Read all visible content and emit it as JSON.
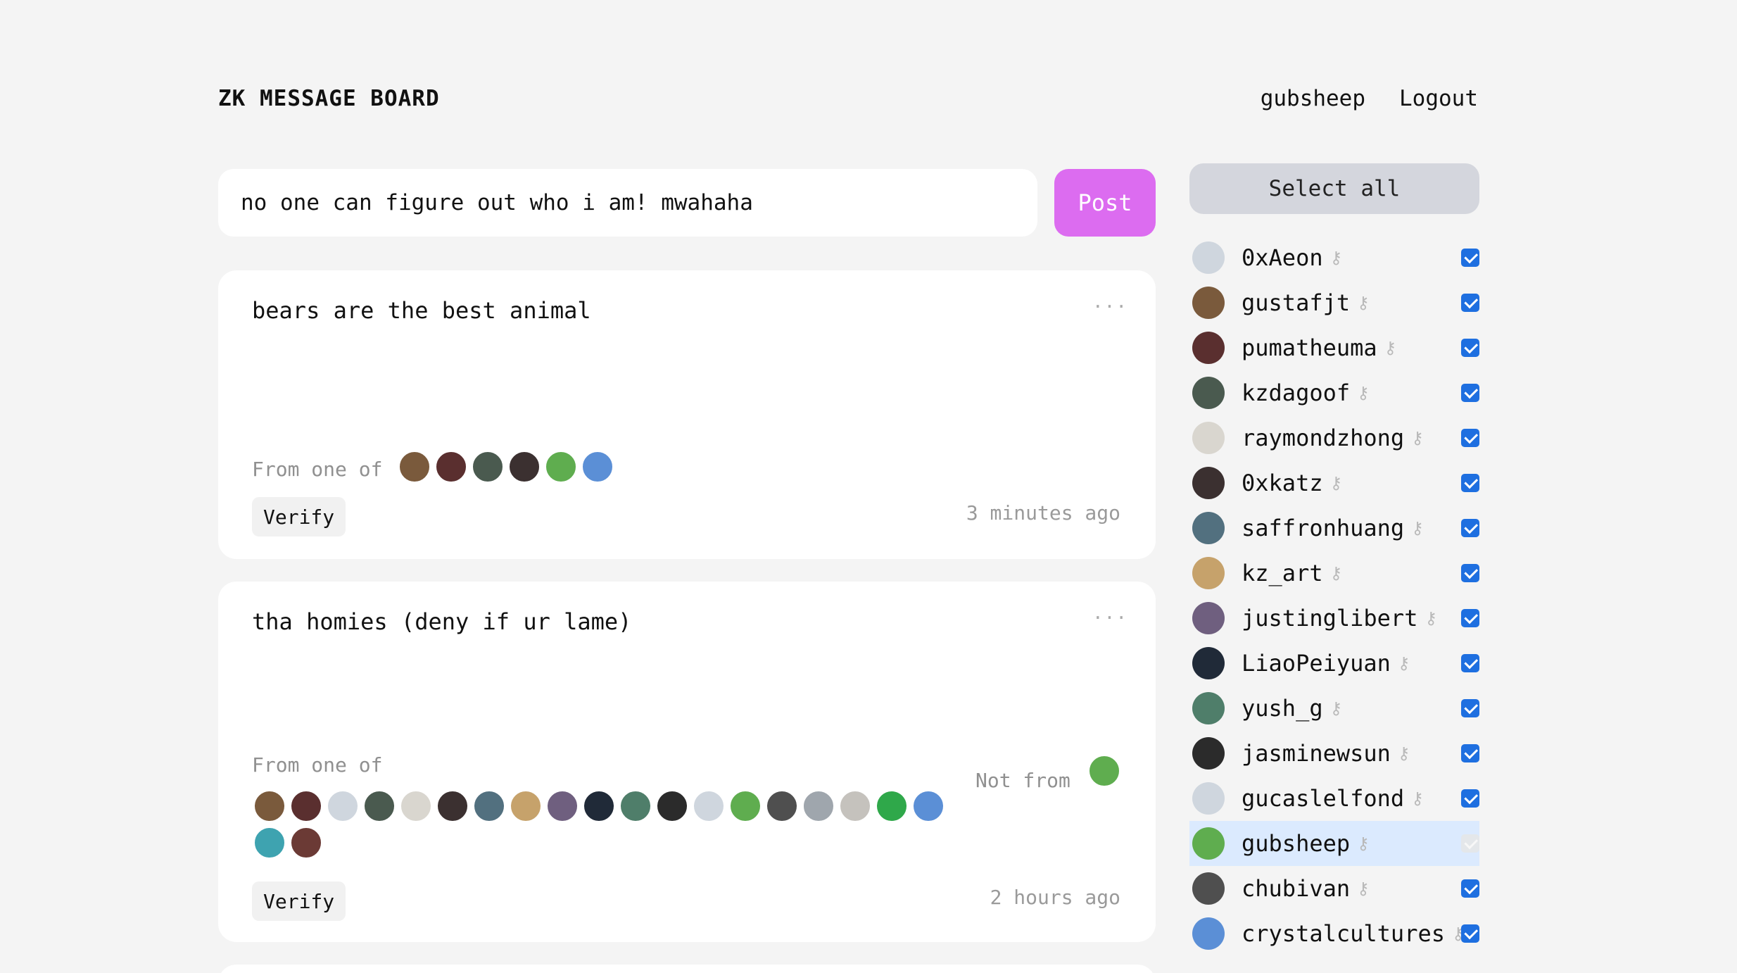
{
  "header": {
    "brand": "ZK MESSAGE BOARD",
    "username": "gubsheep",
    "logout_label": "Logout"
  },
  "composer": {
    "value": "no one can figure out who i am! mwahaha",
    "post_label": "Post"
  },
  "posts": [
    {
      "text": "bears are the best animal",
      "more": "...",
      "from_label": "From one of",
      "verify_label": "Verify",
      "timestamp": "3 minutes ago",
      "from_avatars": [
        "#7a5a3c",
        "#5a2f2f",
        "#4a5a4f",
        "#3b3030",
        "#5fad4f",
        "#5b8fd6"
      ]
    },
    {
      "text": "tha homies (deny if ur lame)",
      "more": "...",
      "from_label": "From one of",
      "not_from_label": "Not from",
      "verify_label": "Verify",
      "timestamp": "2 hours ago",
      "from_avatars": [
        "#7a5a3c",
        "#5a2f2f",
        "#cfd6de",
        "#4a5a4f",
        "#d9d6cf",
        "#3b3030",
        "#52707f",
        "#c6a26b",
        "#6f5f7f",
        "#202a38",
        "#4f7e6a",
        "#2b2b2b",
        "#cfd6de",
        "#5fad4f",
        "#4f4f4f",
        "#9fa6ad",
        "#c5c2bd",
        "#2fa84a",
        "#5b8fd6",
        "#3ea3b0",
        "#6b3a35"
      ],
      "not_from_avatars": [
        "#5fad4f"
      ]
    }
  ],
  "sidebar": {
    "select_all_label": "Select all",
    "users": [
      {
        "name": "0xAeon",
        "avatar_color": "#cfd6de",
        "checked": true
      },
      {
        "name": "gustafjt",
        "avatar_color": "#7a5a3c",
        "checked": true
      },
      {
        "name": "pumatheuma",
        "avatar_color": "#5a2f2f",
        "checked": true
      },
      {
        "name": "kzdagoof",
        "avatar_color": "#4a5a4f",
        "checked": true
      },
      {
        "name": "raymondzhong",
        "avatar_color": "#d9d6cf",
        "checked": true
      },
      {
        "name": "0xkatz",
        "avatar_color": "#3b3030",
        "checked": true
      },
      {
        "name": "saffronhuang",
        "avatar_color": "#52707f",
        "checked": true
      },
      {
        "name": "kz_art",
        "avatar_color": "#c6a26b",
        "checked": true
      },
      {
        "name": "justinglibert",
        "avatar_color": "#6f5f7f",
        "checked": true
      },
      {
        "name": "LiaoPeiyuan",
        "avatar_color": "#202a38",
        "checked": true
      },
      {
        "name": "yush_g",
        "avatar_color": "#4f7e6a",
        "checked": true
      },
      {
        "name": "jasminewsun",
        "avatar_color": "#2b2b2b",
        "checked": true
      },
      {
        "name": "gucaslelfond",
        "avatar_color": "#cfd6de",
        "checked": true
      },
      {
        "name": "gubsheep",
        "avatar_color": "#5fad4f",
        "checked": true,
        "highlighted": true,
        "disabled": true
      },
      {
        "name": "chubivan",
        "avatar_color": "#4f4f4f",
        "checked": true
      },
      {
        "name": "crystalcultures",
        "avatar_color": "#5b8fd6",
        "checked": true
      }
    ]
  },
  "icons": {
    "key": "key-icon",
    "more": "more-icon"
  },
  "colors": {
    "post_button": "#dc6cf0",
    "checkbox": "#1e6fe0",
    "select_all_bg": "#d4d6dd",
    "highlight_row": "#dbeafe"
  }
}
